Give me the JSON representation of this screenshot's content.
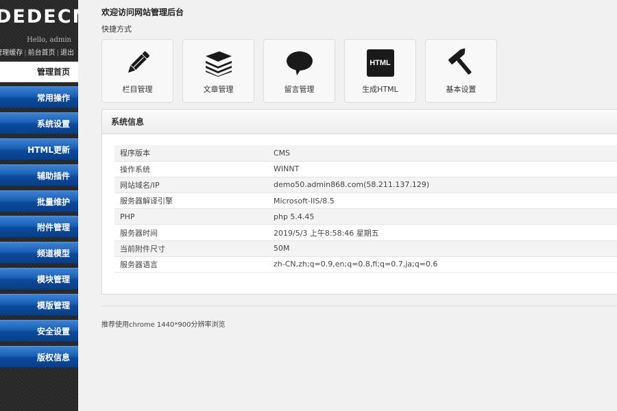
{
  "sidebar": {
    "logo": "DEDECMS",
    "hello": "Hello, admin",
    "links": [
      "管理缓存",
      "前台首页",
      "退出"
    ],
    "home": "管理首页",
    "items": [
      "常用操作",
      "系统设置",
      "HTML更新",
      "辅助插件",
      "批量维护",
      "附件管理",
      "频道模型",
      "模块管理",
      "模版管理",
      "安全设置",
      "版权信息"
    ]
  },
  "main": {
    "welcome": "欢迎访问网站管理后台",
    "quick_label": "快捷方式",
    "shortcuts": [
      {
        "label": "栏目管理",
        "icon": "pencil-icon"
      },
      {
        "label": "文章管理",
        "icon": "papers-stack-icon"
      },
      {
        "label": "留言管理",
        "icon": "speech-bubble-icon"
      },
      {
        "label": "生成HTML",
        "icon": "html-icon",
        "icon_text": "HTML"
      },
      {
        "label": "基本设置",
        "icon": "hammer-icon"
      }
    ],
    "panel_title": "系统信息",
    "info_rows": [
      {
        "key": "程序版本",
        "value": "CMS"
      },
      {
        "key": "操作系统",
        "value": "WINNT"
      },
      {
        "key": "网站域名/IP",
        "value": "demo50.admin868.com(58.211.137.129)"
      },
      {
        "key": "服务器解译引擎",
        "value": "Microsoft-IIS/8.5"
      },
      {
        "key": "PHP",
        "value": "php 5.4.45"
      },
      {
        "key": "服务器时间",
        "value": "2019/5/3 上午8:58:46 星期五"
      },
      {
        "key": "当前附件尺寸",
        "value": "50M"
      },
      {
        "key": "服务器语言",
        "value": "zh-CN,zh;q=0.9,en;q=0.8,fi;q=0.7,ja;q=0.6"
      }
    ],
    "footer_note": "推荐使用chrome 1440*900分辨率浏览"
  },
  "colors": {
    "nav_blue": "#1a5fb4",
    "sidebar_dark": "#262626",
    "page_bg": "#f1f1f1"
  }
}
